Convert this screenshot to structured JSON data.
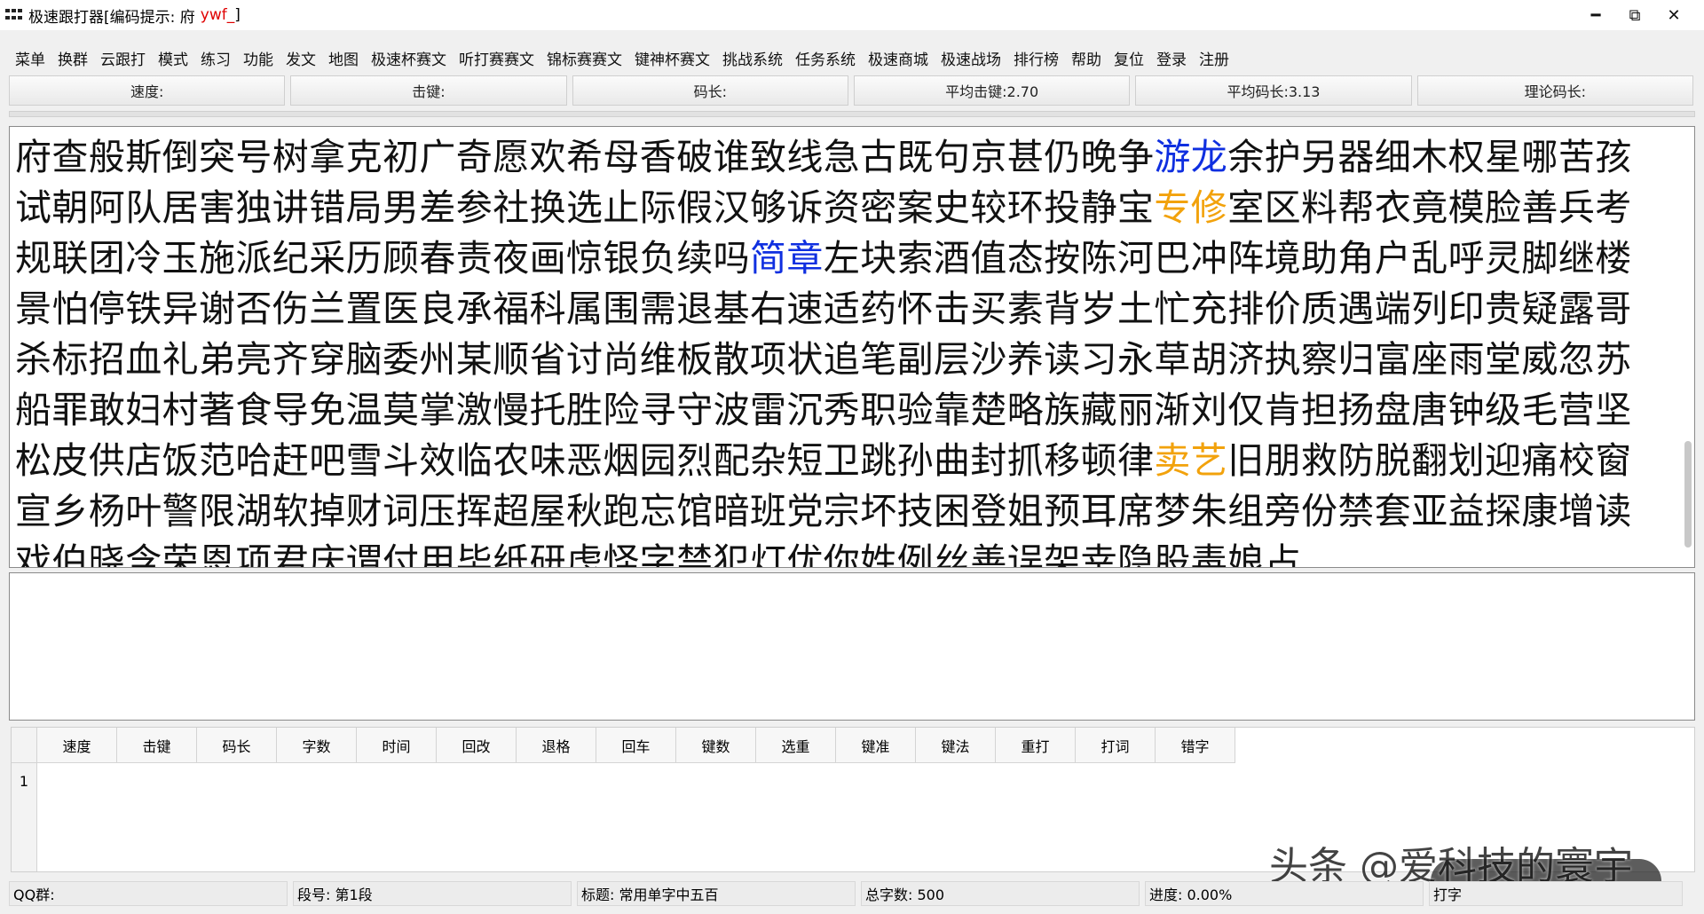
{
  "titlebar": {
    "title": "极速跟打器[编码提示: 府",
    "hint_code": "ywf_",
    "close_bracket": "]",
    "minimize_glyph": "━",
    "restore_glyph": "⧉",
    "close_glyph": "✕"
  },
  "menu": [
    "菜单",
    "换群",
    "云跟打",
    "模式",
    "练习",
    "功能",
    "发文",
    "地图",
    "极速杯赛文",
    "听打赛赛文",
    "锦标赛赛文",
    "键神杯赛文",
    "挑战系统",
    "任务系统",
    "极速商城",
    "极速战场",
    "排行榜",
    "帮助",
    "复位",
    "登录",
    "注册"
  ],
  "stats": {
    "speed_label": "速度:",
    "keystroke_label": "击键:",
    "codelen_label": "码长:",
    "avg_keystroke": "平均击键:2.70",
    "avg_codelen": "平均码长:3.13",
    "theory_codelen_label": "理论码长:"
  },
  "text_segments": [
    {
      "text": "府查般斯倒突号树拿克初广奇愿欢希母香破谁致线急古既句京甚仍晚争",
      "hl": ""
    },
    {
      "text": "游龙",
      "hl": "blue"
    },
    {
      "text": "余护另器细木权星哪苦孩试朝阿队居害独讲错局男差参社换选止际假汉够诉资密案史较环投静宝",
      "hl": ""
    },
    {
      "text": "专修",
      "hl": "orange"
    },
    {
      "text": "室区料帮衣竟模脸善兵考规联团冷玉施派纪采历顾春责夜画惊银负续吗",
      "hl": ""
    },
    {
      "text": "简章",
      "hl": "blue"
    },
    {
      "text": "左块索酒值态按陈河巴冲阵境助角户乱呼灵脚继楼景怕停铁异谢否伤兰置医良承福科属围需退基右速适药怀击买素背岁土忙充排价质遇端列印贵疑露哥杀标招血礼弟亮齐穿脑委州某顺省讨尚维板散项状追笔副层沙养读习永草胡济执察归富座雨堂威忽苏船罪敢妇村著食导免温莫掌激慢托胜险寻守波雷沉秀职验靠楚略族藏丽渐刘仅肯担扬盘唐钟级毛营坚松皮供店饭范哈赶吧雪斗效临农味恶烟园烈配杂短卫跳孙曲封抓移顿律",
      "hl": ""
    },
    {
      "text": "卖艺",
      "hl": "orange"
    },
    {
      "text": "旧朋救防脱翻划迎痛校窗宣乡杨叶警限湖软掉财词压挥超屋秋跑忘馆暗班党宗坏技困登姐预耳席梦朱组旁份禁套亚益探康增读戏伯晓含荣恩项君庆谓付用毕纸研虑怪字禁犯灯优你姓例丝善误架幸隐股毒娘占",
      "hl": ""
    }
  ],
  "table": {
    "headers": [
      "速度",
      "击键",
      "码长",
      "字数",
      "时间",
      "回改",
      "退格",
      "回车",
      "键数",
      "选重",
      "键准",
      "键法",
      "重打",
      "打词",
      "错字"
    ],
    "row_number": "1"
  },
  "watermark": "头条 @爱科技的寰宇",
  "status": {
    "qq_group": "QQ群:",
    "segment": "段号: 第1段",
    "title": "标题: 常用单字中五百",
    "total_chars": "总字数: 500",
    "progress": "进度: 0.00%",
    "typing": "打字"
  }
}
